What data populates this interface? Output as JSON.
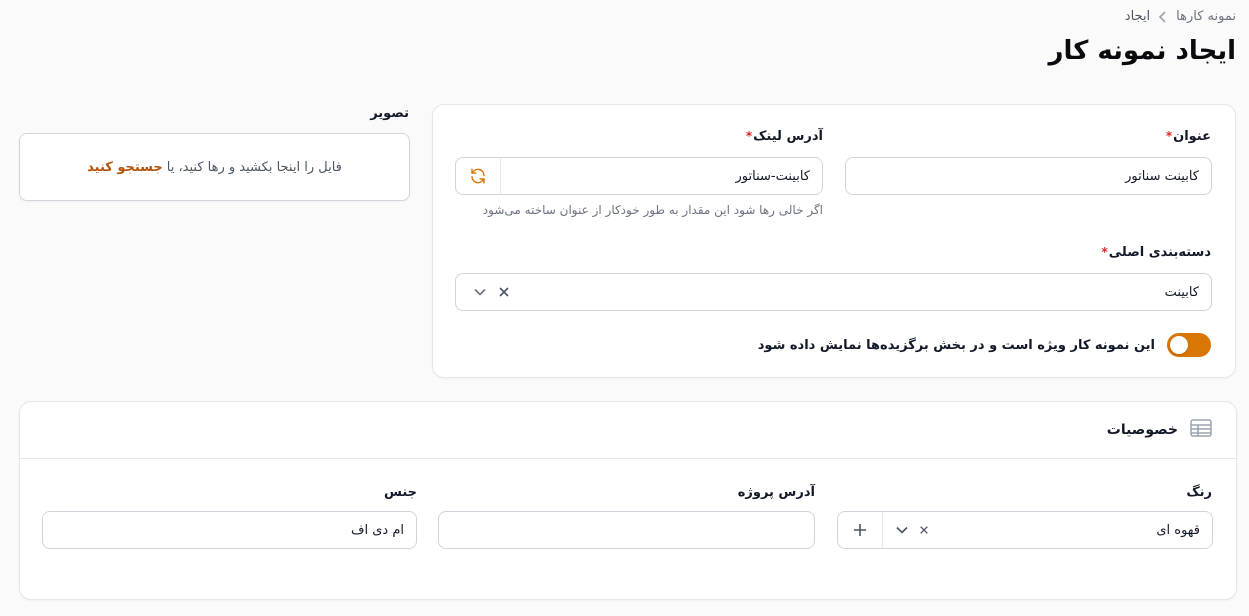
{
  "breadcrumb": {
    "parent": "نمونه کارها",
    "current": "ایجاد"
  },
  "page": {
    "title": "ایجاد نمونه کار"
  },
  "form": {
    "title_label": "عنوان",
    "title_value": "کابینت سناتور",
    "slug_label": "آدرس لینک",
    "slug_value": "کابینت-سناتور",
    "slug_hint": "اگر خالی رها شود این مقدار به طور خودکار از عنوان ساخته می‌شود",
    "category_label": "دسته‌بندی اصلی",
    "category_value": "کابینت",
    "featured_label": "این نمونه کار ویژه است و در بخش برگزیده‌ها نمایش داده شود",
    "featured_on": true,
    "required_mark": "*"
  },
  "image": {
    "label": "تصویر",
    "drop_text": "فایل را اینجا بکشید و رها کنید، یا",
    "browse_link": "جستجو کنید"
  },
  "specs": {
    "title": "خصوصیات",
    "color_label": "رنگ",
    "color_value": "قهوه ای",
    "project_address_label": "آدرس پروژه",
    "project_address_value": "",
    "material_label": "جنس",
    "material_value": "ام دی اف"
  },
  "colors": {
    "accent": "#d97706",
    "link": "#b45309",
    "required": "#dc2626"
  }
}
